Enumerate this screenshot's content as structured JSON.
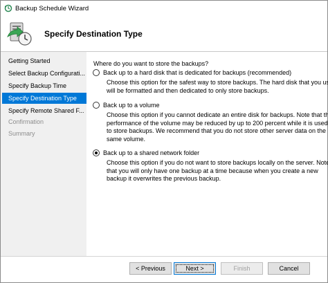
{
  "window": {
    "title": "Backup Schedule Wizard"
  },
  "header": {
    "title": "Specify Destination Type"
  },
  "nav": {
    "items": [
      {
        "label": "Getting Started",
        "state": "normal"
      },
      {
        "label": "Select Backup Configurati...",
        "state": "normal"
      },
      {
        "label": "Specify Backup Time",
        "state": "normal"
      },
      {
        "label": "Specify Destination Type",
        "state": "selected"
      },
      {
        "label": "Specify Remote Shared F...",
        "state": "normal"
      },
      {
        "label": "Confirmation",
        "state": "disabled"
      },
      {
        "label": "Summary",
        "state": "disabled"
      }
    ]
  },
  "main": {
    "question": "Where do you want to store the backups?",
    "options": [
      {
        "label": "Back up to a hard disk that is dedicated for backups (recommended)",
        "checked": false,
        "description": [
          "Choose this option for the safest way to store backups. The hard disk that you use",
          "will be formatted and then dedicated to only store backups."
        ]
      },
      {
        "label": "Back up to a volume",
        "checked": false,
        "description": [
          "Choose this option if you cannot dedicate an entire disk for backups. Note that the",
          "performance of the volume may be reduced by up to 200 percent while it is used",
          "to store backups. We recommend that you do not store other server data on the",
          "same volume."
        ]
      },
      {
        "label": "Back up to a shared network folder",
        "checked": true,
        "description": [
          "Choose this option if you do not want to store backups locally on the server. Note",
          "that you will only have one backup at a time because when you create a new",
          "backup it overwrites the previous backup."
        ]
      }
    ]
  },
  "buttons": {
    "previous": "< Previous",
    "next": "Next >",
    "finish": "Finish",
    "cancel": "Cancel"
  },
  "colors": {
    "selected_nav_bg": "#0078d7",
    "nav_bg": "#f0f0f0",
    "disabled_text": "#8d8d8d"
  }
}
